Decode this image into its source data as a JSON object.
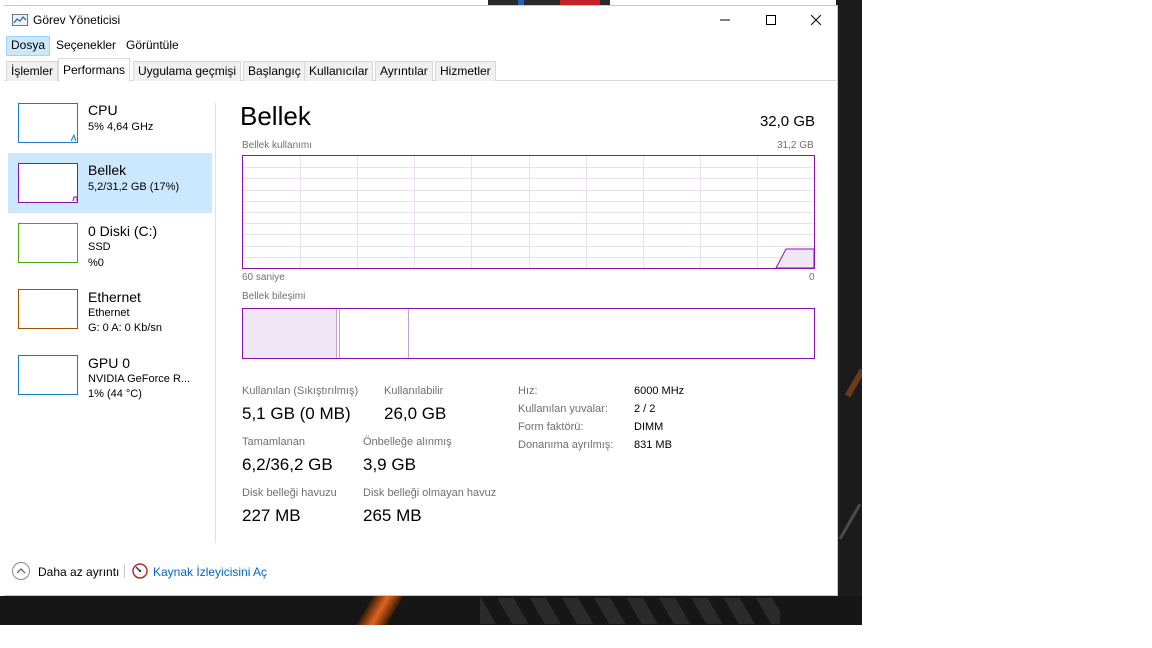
{
  "window": {
    "title": "Görev Yöneticisi"
  },
  "menu": {
    "items": [
      "Dosya",
      "Seçenekler",
      "Görüntüle"
    ]
  },
  "tabs": [
    "İşlemler",
    "Performans",
    "Uygulama geçmişi",
    "Başlangıç",
    "Kullanıcılar",
    "Ayrıntılar",
    "Hizmetler"
  ],
  "sidebar": {
    "items": [
      {
        "name": "CPU",
        "sub1": "5% 4,64 GHz",
        "sub2": "",
        "color": "#1c7cc1"
      },
      {
        "name": "Bellek",
        "sub1": "5,2/31,2 GB (17%)",
        "sub2": "",
        "color": "#8b12ae"
      },
      {
        "name": "0 Diski (C:)",
        "sub1": "SSD",
        "sub2": "%0",
        "color": "#4da60c"
      },
      {
        "name": "Ethernet",
        "sub1": "Ethernet",
        "sub2": "G: 0 A: 0 Kb/sn",
        "color": "#a74f01"
      },
      {
        "name": "GPU 0",
        "sub1": "NVIDIA GeForce R...",
        "sub2": "1% (44 °C)",
        "color": "#1c7cc1"
      }
    ]
  },
  "main": {
    "title": "Bellek",
    "total": "32,0 GB",
    "usage_label": "Bellek kullanımı",
    "usage_max": "31,2 GB",
    "time_left": "60 saniye",
    "time_right": "0",
    "composition_label": "Bellek bileşimi",
    "accent": "#8b12ae",
    "usage_fraction": 0.17
  },
  "stats": {
    "in_use_label": "Kullanılan (Sıkıştırılmış)",
    "in_use": "5,1 GB (0 MB)",
    "available_label": "Kullanılabilir",
    "available": "26,0 GB",
    "committed_label": "Tamamlanan",
    "committed": "6,2/36,2 GB",
    "cached_label": "Önbelleğe alınmış",
    "cached": "3,9 GB",
    "paged_label": "Disk belleği havuzu",
    "paged": "227 MB",
    "nonpaged_label": "Disk belleği olmayan havuz",
    "nonpaged": "265 MB"
  },
  "specs": [
    {
      "label": "Hız:",
      "value": "6000 MHz"
    },
    {
      "label": "Kullanılan yuvalar:",
      "value": "2 / 2"
    },
    {
      "label": "Form faktörü:",
      "value": "DIMM"
    },
    {
      "label": "Donanıma ayrılmış:",
      "value": "831 MB"
    }
  ],
  "footer": {
    "less_details": "Daha az ayrıntı",
    "resource_monitor": "Kaynak İzleyicisini Aç"
  }
}
